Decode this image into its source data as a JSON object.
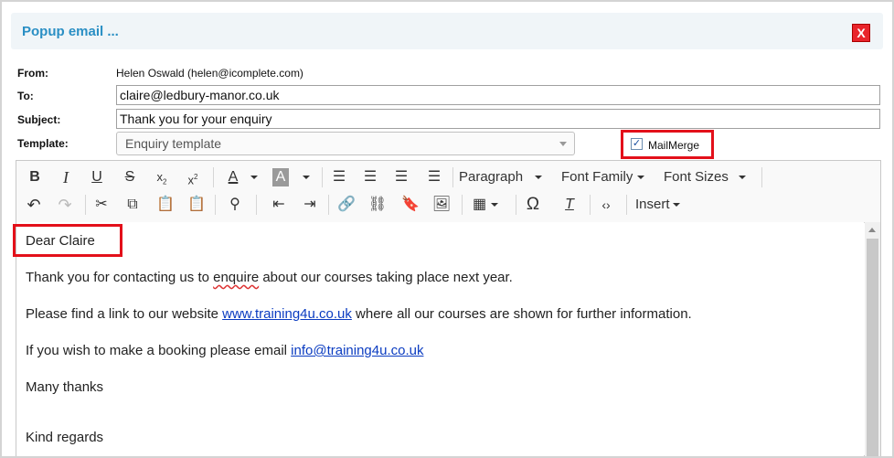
{
  "dialog": {
    "title": "Popup email ...",
    "close_glyph": "X"
  },
  "form": {
    "from_label": "From:",
    "from_value": "Helen Oswald (helen@icomplete.com)",
    "to_label": "To:",
    "to_value": "claire@ledbury-manor.co.uk",
    "subject_label": "Subject:",
    "subject_value": "Thank you for your enquiry",
    "template_label": "Template:",
    "template_value": "Enquiry template",
    "mailmerge_label": "MailMerge",
    "mailmerge_checked": true
  },
  "toolbar": {
    "paragraph_label": "Paragraph",
    "font_family_label": "Font Family",
    "font_sizes_label": "Font Sizes",
    "insert_label": "Insert"
  },
  "body": {
    "greeting": "Dear Claire",
    "line1_pre": "Thank you for contacting us to ",
    "line1_word": "enquire",
    "line1_post": " about our courses taking place next year.",
    "line2_pre": "Please find a link to our website ",
    "line2_link": "www.training4u.co.uk",
    "line2_post": " where all our courses are shown for further information.",
    "line3_pre": "If you wish to make a booking please email ",
    "line3_link": "info@training4u.co.uk",
    "line4": "Many thanks",
    "line5": "Kind regards"
  },
  "colors": {
    "title": "#2a8fc4",
    "highlight_box": "#e3101a",
    "link": "#0b3cc1"
  }
}
